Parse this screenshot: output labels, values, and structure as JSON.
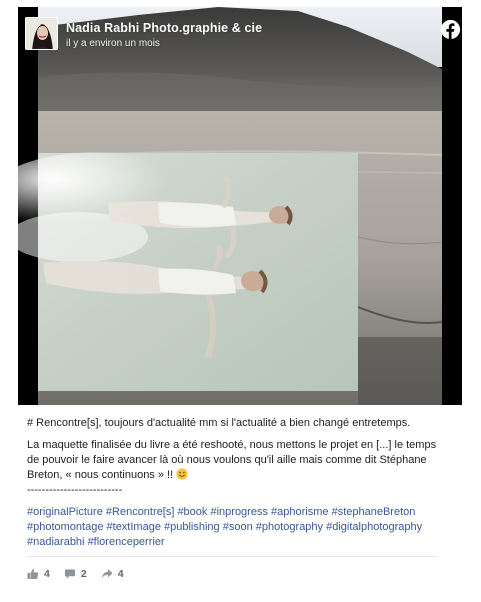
{
  "post": {
    "page_name": "Nadia Rabhi Photo.graphie & cie",
    "timestamp": "il y a environ un mois",
    "line1": "# Rencontre[s], toujours d'actualité mm si l'actualité a bien changé entretemps.",
    "line2": "La maquette finalisée du livre a été reshooté, nous mettons le projet en [...] le temps de pouvoir le faire avancer là où nous voulons qu'il aille mais comme dit Stéphane Breton, « nous continuons » !! ",
    "separator": "--------------------------",
    "hashtags": [
      "#originalPicture",
      "#Rencontre[s]",
      "#book",
      "#inprogress",
      "#aphorisme",
      "#stephaneBreton",
      "#photomontage",
      "#textImage",
      "#publishing",
      "#soon",
      "#photography",
      "#digitalphotography",
      "#nadiarabhi",
      "#florenceperrier"
    ]
  },
  "reactions": {
    "likes": "4",
    "comments": "2",
    "shares": "4"
  },
  "icons": {
    "brand": "facebook-icon",
    "like": "thumbs-up-icon",
    "comment": "comment-icon",
    "share": "share-icon",
    "emoji": "smile-emoji-icon"
  },
  "colors": {
    "link": "#385898",
    "facebook": "#ffffff",
    "meta": "#606770"
  }
}
